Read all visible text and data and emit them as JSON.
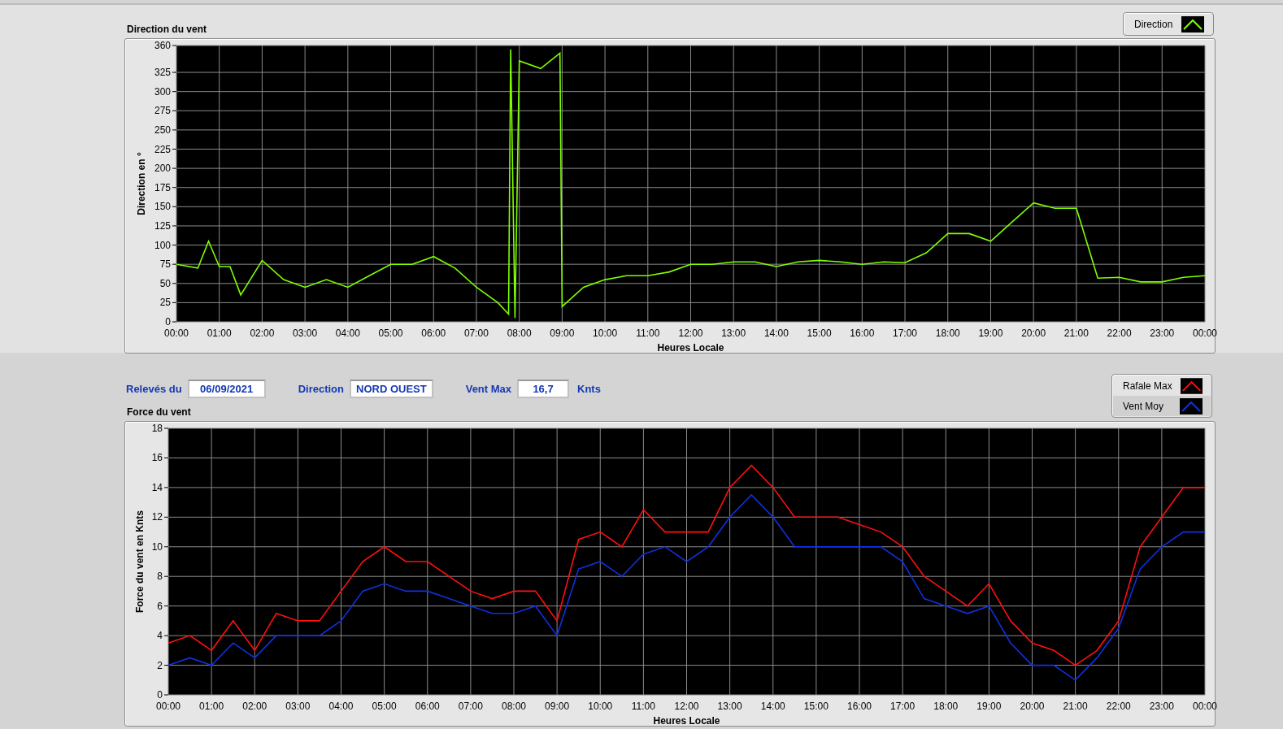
{
  "direction_chart": {
    "chart_data": {
      "type": "line",
      "grid": true,
      "title": "Direction du vent",
      "xlabel": "Heures Locale",
      "ylabel": "Direction en °",
      "xlim": [
        0,
        24
      ],
      "ylim": [
        0,
        360
      ],
      "yticks": [
        0,
        25,
        50,
        75,
        100,
        125,
        150,
        175,
        200,
        225,
        250,
        275,
        300,
        325,
        360
      ],
      "xticks": [
        {
          "value": 0,
          "label": "00:00"
        },
        {
          "value": 1,
          "label": "01:00"
        },
        {
          "value": 2,
          "label": "02:00"
        },
        {
          "value": 3,
          "label": "03:00"
        },
        {
          "value": 4,
          "label": "04:00"
        },
        {
          "value": 5,
          "label": "05:00"
        },
        {
          "value": 6,
          "label": "06:00"
        },
        {
          "value": 7,
          "label": "07:00"
        },
        {
          "value": 8,
          "label": "08:00"
        },
        {
          "value": 9,
          "label": "09:00"
        },
        {
          "value": 10,
          "label": "10:00"
        },
        {
          "value": 11,
          "label": "11:00"
        },
        {
          "value": 12,
          "label": "12:00"
        },
        {
          "value": 13,
          "label": "13:00"
        },
        {
          "value": 14,
          "label": "14:00"
        },
        {
          "value": 15,
          "label": "15:00"
        },
        {
          "value": 16,
          "label": "16:00"
        },
        {
          "value": 17,
          "label": "17:00"
        },
        {
          "value": 18,
          "label": "18:00"
        },
        {
          "value": 19,
          "label": "19:00"
        },
        {
          "value": 20,
          "label": "20:00"
        },
        {
          "value": 21,
          "label": "21:00"
        },
        {
          "value": 22,
          "label": "22:00"
        },
        {
          "value": 23,
          "label": "23:00"
        },
        {
          "value": 24,
          "label": "00:00"
        }
      ],
      "x": [
        0,
        0.5,
        0.75,
        1,
        1.25,
        1.5,
        2,
        2.5,
        3,
        3.5,
        4,
        4.5,
        5,
        5.5,
        6,
        6.5,
        7,
        7.5,
        7.75,
        7.8,
        7.9,
        8,
        8.5,
        8.95,
        9,
        9.5,
        10,
        10.5,
        11,
        11.5,
        12,
        12.5,
        13,
        13.5,
        14,
        14.5,
        15,
        15.5,
        16,
        16.5,
        17,
        17.5,
        18,
        18.5,
        19,
        19.5,
        20,
        20.5,
        21,
        21.5,
        22,
        22.5,
        23,
        23.5,
        24
      ],
      "series": [
        {
          "name": "Direction",
          "color": "#7fff00",
          "values": [
            75,
            70,
            105,
            72,
            72,
            35,
            80,
            55,
            45,
            55,
            45,
            60,
            75,
            75,
            85,
            70,
            45,
            25,
            10,
            355,
            5,
            340,
            330,
            350,
            20,
            45,
            55,
            60,
            60,
            65,
            75,
            75,
            78,
            78,
            72,
            78,
            80,
            78,
            75,
            78,
            77,
            90,
            115,
            115,
            105,
            130,
            155,
            148,
            148,
            57,
            58,
            52,
            52,
            58,
            60
          ]
        }
      ]
    }
  },
  "readings": [
    {
      "label": "Relevés du",
      "value": "06/09/2021"
    },
    {
      "label": "Direction",
      "value": "NORD OUEST"
    },
    {
      "label": "Vent Max",
      "value": "16,7",
      "unit": "Knts"
    }
  ],
  "force_chart": {
    "chart_data": {
      "type": "line",
      "grid": true,
      "title": "Force du vent",
      "xlabel": "Heures Locale",
      "ylabel": "Force du vent en Knts",
      "xlim": [
        0,
        24
      ],
      "ylim": [
        0,
        18
      ],
      "yticks": [
        0,
        2,
        4,
        6,
        8,
        10,
        12,
        14,
        16,
        18
      ],
      "xticks": [
        {
          "value": 0,
          "label": "00:00"
        },
        {
          "value": 1,
          "label": "01:00"
        },
        {
          "value": 2,
          "label": "02:00"
        },
        {
          "value": 3,
          "label": "03:00"
        },
        {
          "value": 4,
          "label": "04:00"
        },
        {
          "value": 5,
          "label": "05:00"
        },
        {
          "value": 6,
          "label": "06:00"
        },
        {
          "value": 7,
          "label": "07:00"
        },
        {
          "value": 8,
          "label": "08:00"
        },
        {
          "value": 9,
          "label": "09:00"
        },
        {
          "value": 10,
          "label": "10:00"
        },
        {
          "value": 11,
          "label": "11:00"
        },
        {
          "value": 12,
          "label": "12:00"
        },
        {
          "value": 13,
          "label": "13:00"
        },
        {
          "value": 14,
          "label": "14:00"
        },
        {
          "value": 15,
          "label": "15:00"
        },
        {
          "value": 16,
          "label": "16:00"
        },
        {
          "value": 17,
          "label": "17:00"
        },
        {
          "value": 18,
          "label": "18:00"
        },
        {
          "value": 19,
          "label": "19:00"
        },
        {
          "value": 20,
          "label": "20:00"
        },
        {
          "value": 21,
          "label": "21:00"
        },
        {
          "value": 22,
          "label": "22:00"
        },
        {
          "value": 23,
          "label": "23:00"
        },
        {
          "value": 24,
          "label": "00:00"
        }
      ],
      "x": [
        0,
        0.5,
        1,
        1.5,
        2,
        2.5,
        3,
        3.5,
        4,
        4.5,
        5,
        5.5,
        6,
        6.5,
        7,
        7.5,
        8,
        8.5,
        9,
        9.5,
        10,
        10.5,
        11,
        11.5,
        12,
        12.5,
        13,
        13.5,
        14,
        14.5,
        15,
        15.5,
        16,
        16.5,
        17,
        17.5,
        18,
        18.5,
        19,
        19.5,
        20,
        20.5,
        21,
        21.5,
        22,
        22.5,
        23,
        23.5,
        24
      ],
      "series": [
        {
          "name": "Rafale Max",
          "color": "#ff1010",
          "values": [
            3.5,
            4,
            3,
            5,
            3,
            5.5,
            5,
            5,
            7,
            9,
            10,
            9,
            9,
            8,
            7,
            6.5,
            7,
            7,
            5,
            10.5,
            11,
            10,
            12.5,
            11,
            11,
            11,
            14,
            15.5,
            14,
            12,
            12,
            12,
            11.5,
            11,
            10,
            8,
            7,
            6,
            7.5,
            5,
            3.5,
            3,
            2,
            3,
            5,
            10,
            12,
            14,
            14
          ]
        },
        {
          "name": "Vent Moy",
          "color": "#1030e0",
          "values": [
            2,
            2.5,
            2,
            3.5,
            2.5,
            4,
            4,
            4,
            5,
            7,
            7.5,
            7,
            7,
            6.5,
            6,
            5.5,
            5.5,
            6,
            4,
            8.5,
            9,
            8,
            9.5,
            10,
            9,
            10,
            12,
            13.5,
            12,
            10,
            10,
            10,
            10,
            10,
            9,
            6.5,
            6,
            5.5,
            6,
            3.5,
            2,
            2,
            1,
            2.5,
            4.5,
            8.5,
            10,
            11,
            11
          ]
        }
      ]
    }
  }
}
